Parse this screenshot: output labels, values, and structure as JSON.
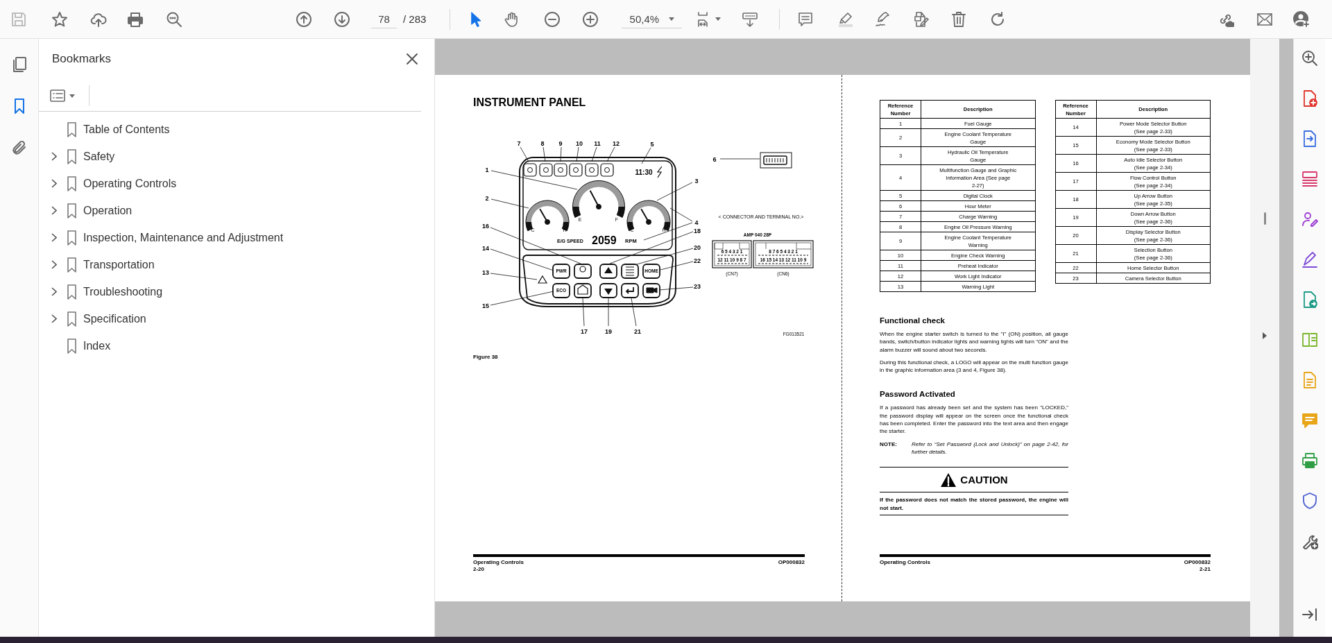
{
  "toolbar": {
    "page_number": "78",
    "page_total": "/ 283",
    "zoom": "50,4%"
  },
  "nav_icons": [
    {
      "selected": false
    },
    {
      "selected": true
    },
    {
      "selected": false
    }
  ],
  "bookmarks": {
    "title": "Bookmarks",
    "items": [
      {
        "label": "Table of Contents",
        "expandable": false
      },
      {
        "label": "Safety",
        "expandable": true
      },
      {
        "label": "Operating Controls",
        "expandable": true
      },
      {
        "label": "Operation",
        "expandable": true
      },
      {
        "label": "Inspection, Maintenance and Adjustment",
        "expandable": true
      },
      {
        "label": "Transportation",
        "expandable": true
      },
      {
        "label": "Troubleshooting",
        "expandable": true
      },
      {
        "label": "Specification",
        "expandable": true
      },
      {
        "label": "Index",
        "expandable": false
      }
    ]
  },
  "left_page": {
    "heading": "INSTRUMENT PANEL",
    "figure": {
      "callouts": [
        "7",
        "8",
        "9",
        "10",
        "11",
        "12",
        "5",
        "1",
        "2",
        "3",
        "6",
        "4",
        "16",
        "18",
        "14",
        "20",
        "22",
        "13",
        "23",
        "15",
        "17",
        "19",
        "21"
      ],
      "clock": "11:30",
      "gauge_labels": [
        "E",
        "F",
        "C",
        "H",
        "C",
        "H"
      ],
      "speed_label": "E/G SPEED",
      "speed_value": "2059",
      "speed_unit": "RPM",
      "button_labels": [
        "PWR",
        "HOME",
        "ECO"
      ],
      "connector_title": "< CONNECTOR AND TERMINAL NO.>",
      "connector_part": "AMP 040 28P",
      "connector_pins": [
        "6 5 4 3 2 1",
        "12 11 10 9 8 7",
        "8 7 6 5 4 3 2 1",
        "16 15 14 13 12 11 10 9"
      ],
      "connector_names": [
        "(CN7)",
        "(CN6)"
      ],
      "code": "FG013521"
    },
    "caption": "Figure 38",
    "footer": {
      "section": "Operating Controls",
      "code": "OP000832",
      "page": "2-20"
    }
  },
  "right_page": {
    "tables": [
      {
        "columns": [
          "Reference Number",
          "Description"
        ],
        "rows": [
          [
            "1",
            "Fuel Gauge"
          ],
          [
            "2",
            "Engine Coolant Temperature\nGauge"
          ],
          [
            "3",
            "Hydraulic Oil Temperature\nGauge"
          ],
          [
            "4",
            "Multifunction Gauge and Graphic\nInformation Area (See page\n2-27)"
          ],
          [
            "5",
            "Digital Clock"
          ],
          [
            "6",
            "Hour Meter"
          ],
          [
            "7",
            "Charge Warning"
          ],
          [
            "8",
            "Engine Oil Pressure Warning"
          ],
          [
            "9",
            "Engine Coolant Temperature\nWarning"
          ],
          [
            "10",
            "Engine Check Warning"
          ],
          [
            "11",
            "Preheat Indicator"
          ],
          [
            "12",
            "Work Light Indicator"
          ],
          [
            "13",
            "Warning Light"
          ]
        ]
      },
      {
        "columns": [
          "Reference Number",
          "Description"
        ],
        "rows": [
          [
            "14",
            "Power Mode Selector Button\n(See page 2-33)"
          ],
          [
            "15",
            "Economy Mode Selector Button\n(See page 2-33)"
          ],
          [
            "16",
            "Auto Idle Selector Button\n(See page 2-34)"
          ],
          [
            "17",
            "Flow Control Button\n(See page 2-34)"
          ],
          [
            "18",
            "Up Arrow Button\n(See page 2-35)"
          ],
          [
            "19",
            "Down Arrow Button\n(See page 2-36)"
          ],
          [
            "20",
            "Display Selector Button\n(See page 2-36)"
          ],
          [
            "21",
            "Selection Button\n(See page 2-36)"
          ],
          [
            "22",
            "Home Selector Button"
          ],
          [
            "23",
            "Camera Selector Button"
          ]
        ]
      }
    ],
    "sections": [
      {
        "heading": "Functional check",
        "paragraphs": [
          "When the engine starter switch is turned to the \"I\" (ON) position, all gauge bands, switch/button indicator lights and warning lights will turn \"ON\" and the alarm buzzer will sound about two seconds.",
          "During this functional check, a LOGO will appear on the multi function gauge in the graphic information area (3 and 4, Figure 38)."
        ]
      },
      {
        "heading": "Password Activated",
        "paragraphs": [
          "If a password has already been set and the system has been \"LOCKED,\" the password display will appear on the screen once the functional check has been completed. Enter the password into the text area and then engage the starter."
        ]
      }
    ],
    "note": {
      "label": "NOTE:",
      "text": "Refer to “Set Password (Lock and Unlock)” on page 2-42, for further details."
    },
    "caution": {
      "title": "CAUTION",
      "text": "If the password does not match the stored password, the engine will not start."
    },
    "footer": {
      "section": "Operating Controls",
      "code": "OP000832",
      "page": "2-21"
    }
  }
}
